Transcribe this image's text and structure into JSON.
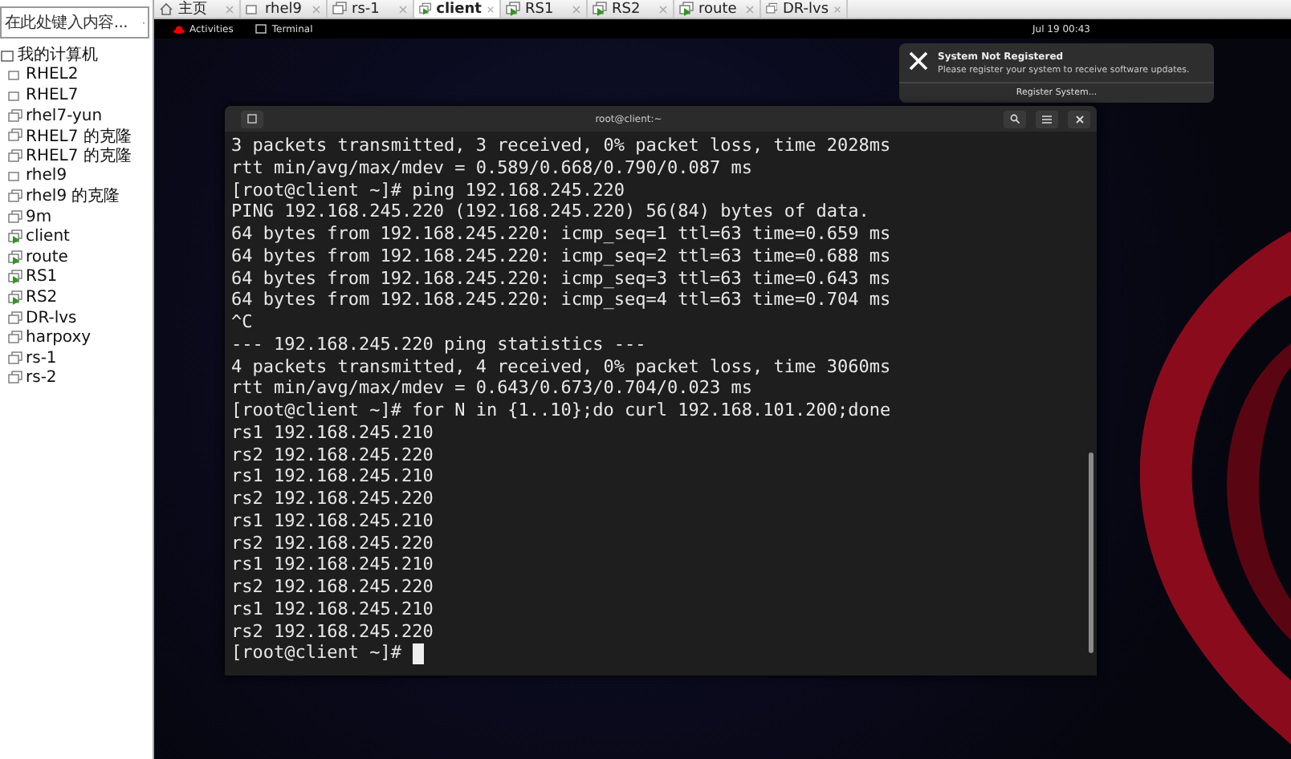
{
  "sidebar": {
    "search": {
      "placeholder": "在此处键入内容..."
    },
    "tree": [
      {
        "label": "我的计算机",
        "kind": "folder",
        "children": [
          {
            "label": "RHEL2",
            "kind": "vm",
            "running": false
          },
          {
            "label": "RHEL7",
            "kind": "vm",
            "running": false
          },
          {
            "label": "rhel7-yun",
            "kind": "clone",
            "running": false
          },
          {
            "label": "RHEL7 的克隆",
            "kind": "clone",
            "running": false
          },
          {
            "label": "RHEL7 的克隆",
            "kind": "clone",
            "running": false
          },
          {
            "label": "rhel9",
            "kind": "vm",
            "running": false
          },
          {
            "label": "rhel9 的克隆",
            "kind": "clone",
            "running": false
          },
          {
            "label": "9m",
            "kind": "clone",
            "running": false
          },
          {
            "label": "client",
            "kind": "clone",
            "running": true
          },
          {
            "label": "route",
            "kind": "clone",
            "running": true
          },
          {
            "label": "RS1",
            "kind": "clone",
            "running": true
          },
          {
            "label": "RS2",
            "kind": "clone",
            "running": true
          },
          {
            "label": "DR-lvs",
            "kind": "clone",
            "running": false
          },
          {
            "label": "harpoxy",
            "kind": "clone",
            "running": false
          },
          {
            "label": "rs-1",
            "kind": "clone",
            "running": false
          },
          {
            "label": "rs-2",
            "kind": "clone",
            "running": false
          }
        ]
      }
    ]
  },
  "tabs": [
    {
      "label": "主页",
      "kind": "home",
      "selected": false
    },
    {
      "label": "rhel9",
      "kind": "vm",
      "running": false,
      "selected": false
    },
    {
      "label": "rs-1",
      "kind": "clone",
      "running": false,
      "selected": false
    },
    {
      "label": "client",
      "kind": "clone",
      "running": true,
      "selected": true
    },
    {
      "label": "RS1",
      "kind": "clone",
      "running": true,
      "selected": false
    },
    {
      "label": "RS2",
      "kind": "clone",
      "running": true,
      "selected": false
    },
    {
      "label": "route",
      "kind": "clone",
      "running": true,
      "selected": false
    },
    {
      "label": "DR-lvs",
      "kind": "clone",
      "running": false,
      "selected": false
    }
  ],
  "top_bar": {
    "activities": "Activities",
    "app": "Terminal",
    "clock": "Jul 19  00:43"
  },
  "notification": {
    "title": "System Not Registered",
    "body": "Please register your system to receive software updates.",
    "action": "Register System..."
  },
  "terminal": {
    "title": "root@client:~",
    "lines": [
      "3 packets transmitted, 3 received, 0% packet loss, time 2028ms",
      "rtt min/avg/max/mdev = 0.589/0.668/0.790/0.087 ms",
      "[root@client ~]# ping 192.168.245.220",
      "PING 192.168.245.220 (192.168.245.220) 56(84) bytes of data.",
      "64 bytes from 192.168.245.220: icmp_seq=1 ttl=63 time=0.659 ms",
      "64 bytes from 192.168.245.220: icmp_seq=2 ttl=63 time=0.688 ms",
      "64 bytes from 192.168.245.220: icmp_seq=3 ttl=63 time=0.643 ms",
      "64 bytes from 192.168.245.220: icmp_seq=4 ttl=63 time=0.704 ms",
      "^C",
      "--- 192.168.245.220 ping statistics ---",
      "4 packets transmitted, 4 received, 0% packet loss, time 3060ms",
      "rtt min/avg/max/mdev = 0.643/0.673/0.704/0.023 ms",
      "[root@client ~]# for N in {1..10};do curl 192.168.101.200;done",
      "rs1 192.168.245.210",
      "rs2 192.168.245.220",
      "rs1 192.168.245.210",
      "rs2 192.168.245.220",
      "rs1 192.168.245.210",
      "rs2 192.168.245.220",
      "rs1 192.168.245.210",
      "rs2 192.168.245.220",
      "rs1 192.168.245.210",
      "rs2 192.168.245.220"
    ],
    "prompt": "[root@client ~]#"
  }
}
